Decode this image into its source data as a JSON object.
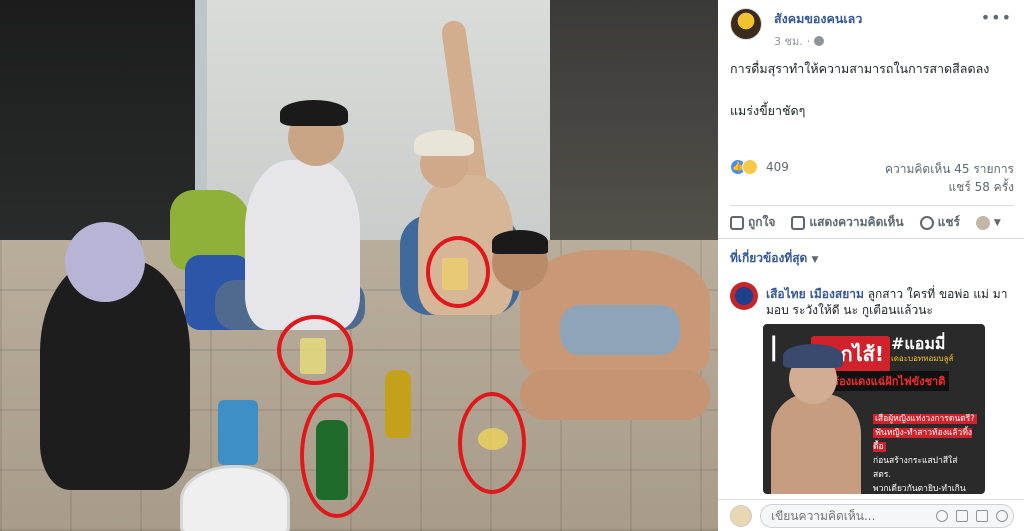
{
  "post": {
    "page_name": "สังคมของคนเลว",
    "time": "3 ชม.",
    "text_line1": "การดื่มสุราทำให้ความสามารถในการสาดสีลดลง",
    "text_line2": "แมร่งขี้ยาชัดๆ",
    "reaction_count": "409",
    "comments_count": "ความคิดเห็น 45 รายการ",
    "shares_count": "แชร์ 58 ครั้ง"
  },
  "actions": {
    "like": "ถูกใจ",
    "comment": "แสดงความคิดเห็น",
    "share": "แชร์"
  },
  "relevant_label": "ที่เกี่ยวข้องที่สุด",
  "comment": {
    "author": "เสือไทย เมืองสยาม",
    "text": " ลูกสาว ใครที่ ขอพ่อ แม่ มามอบ ระวังให้ดี นะ กูเตือนแล้วนะ"
  },
  "comment_image": {
    "title": "ลากไส้!",
    "hashtag": "#แอมมี่",
    "sub": "เดอะบอททอมบลูส์",
    "headline": "นักร้องแดงแฉ่ฝักไฟขังชาติ",
    "lines": [
      "เสือผู้หญิงแห่งวงการดนตรี?",
      "ฟันหญิง-ทำสาวท้องแล้วทิ้งดื้อ",
      "ก่อนสร้างกระแสปาสีใส่ สตร.",
      "พวกเดียวกันตายิบ-ทำเกินเหตุ?"
    ]
  },
  "comment_input": {
    "placeholder": "เขียนความคิดเห็น..."
  },
  "colors": {
    "link": "#365899",
    "circle": "#e0181c",
    "accent_red": "#d1212a"
  }
}
